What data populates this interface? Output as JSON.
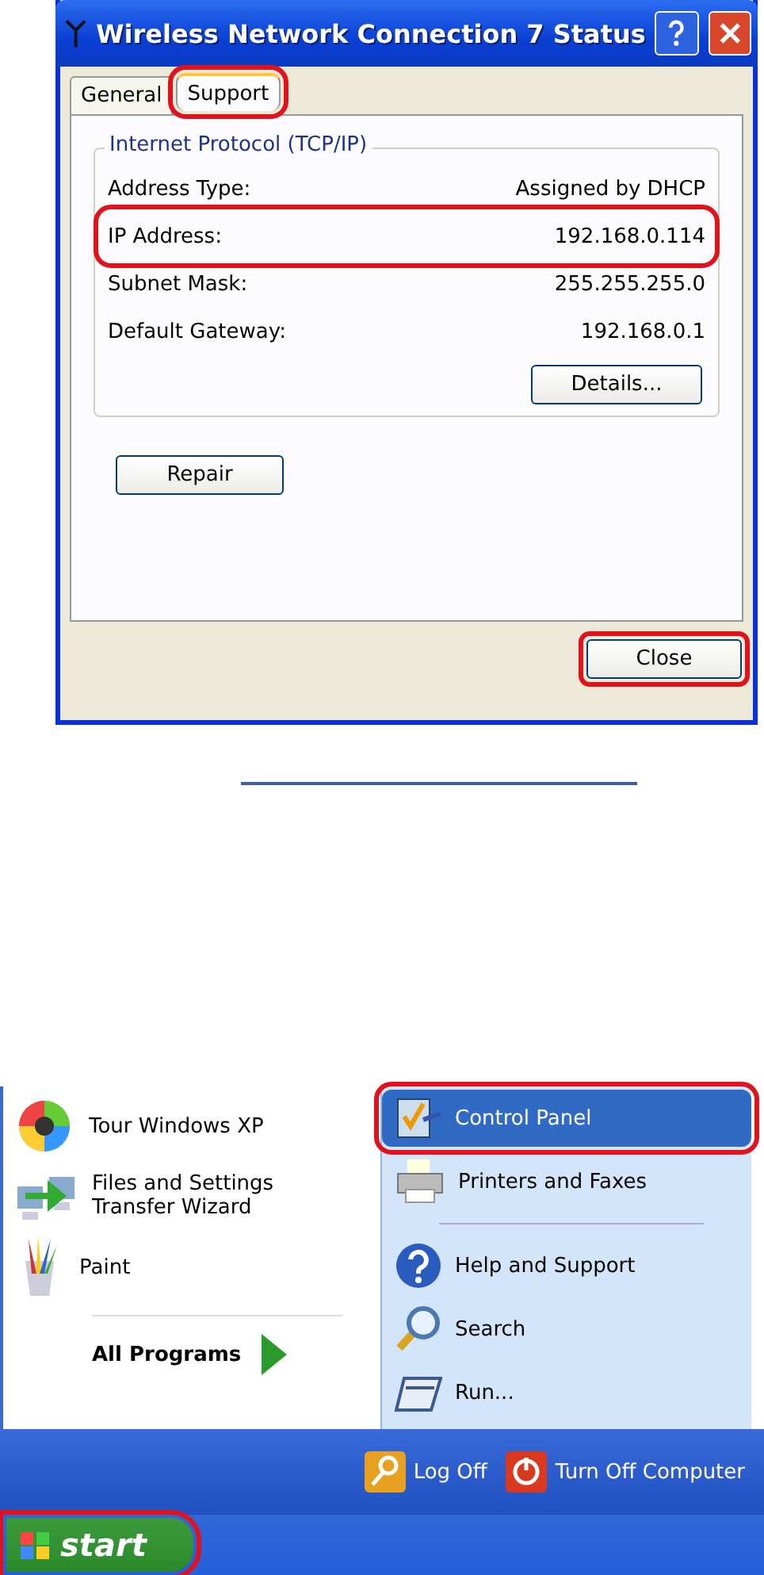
{
  "dialog": {
    "title": "Wireless Network Connection 7 Status",
    "tabs": [
      {
        "label": "General",
        "selected": false,
        "highlighted": false
      },
      {
        "label": "Support",
        "selected": true,
        "highlighted": true
      }
    ],
    "group": {
      "title": "Internet Protocol (TCP/IP)",
      "rows": [
        {
          "label": "Address Type:",
          "value": "Assigned by DHCP",
          "highlighted": false
        },
        {
          "label": "IP Address:",
          "value": "192.168.0.114",
          "highlighted": true
        },
        {
          "label": "Subnet Mask:",
          "value": "255.255.255.0",
          "highlighted": false
        },
        {
          "label": "Default Gateway:",
          "value": "192.168.0.1",
          "highlighted": false
        }
      ],
      "details_button": "Details..."
    },
    "repair_button": "Repair",
    "close_button": {
      "label": "Close",
      "highlighted": true
    }
  },
  "start_menu": {
    "left_items": [
      {
        "label": "Tour Windows XP",
        "kind": "tour"
      },
      {
        "label": "Files and Settings Transfer Wizard",
        "kind": "transfer"
      },
      {
        "label": "Paint",
        "kind": "paint"
      }
    ],
    "all_programs": "All Programs",
    "right_groups": [
      [
        {
          "label": "Control Panel",
          "kind": "control",
          "selected": true,
          "highlighted": true
        },
        {
          "label": "Printers and Faxes",
          "kind": "printer",
          "selected": false,
          "highlighted": false
        }
      ],
      [
        {
          "label": "Help and Support",
          "kind": "help",
          "selected": false,
          "highlighted": false
        },
        {
          "label": "Search",
          "kind": "search",
          "selected": false,
          "highlighted": false
        },
        {
          "label": "Run...",
          "kind": "run",
          "selected": false,
          "highlighted": false
        }
      ]
    ],
    "log_off": "Log Off",
    "turn_off": "Turn Off Computer"
  },
  "taskbar": {
    "start_button": {
      "label": "start",
      "highlighted": true
    }
  }
}
